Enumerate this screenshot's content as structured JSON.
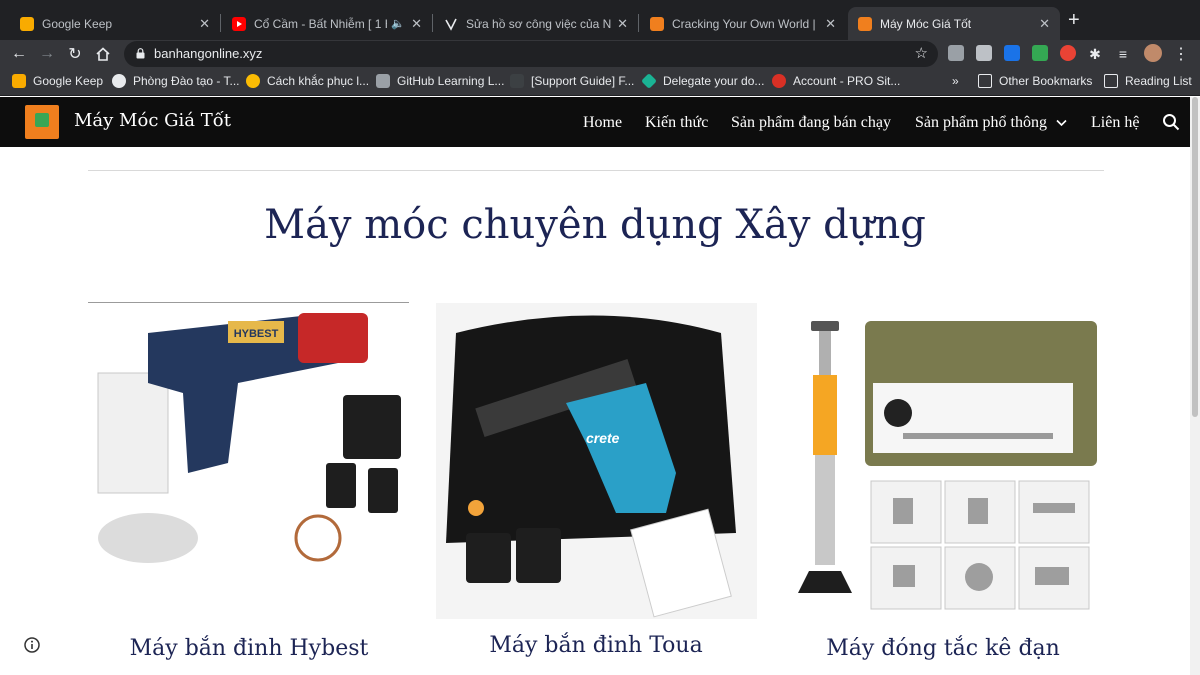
{
  "browser": {
    "tabs": [
      {
        "title": "Google Keep",
        "active": false
      },
      {
        "title": "Cổ Cầm - Bất Nhiễm [ 1 Ho",
        "active": false
      },
      {
        "title": "Sửa hồ sơ công việc của Nguy",
        "active": false
      },
      {
        "title": "Cracking Your Own World | Jus",
        "active": false
      },
      {
        "title": "Máy Móc Giá Tốt",
        "active": true
      }
    ],
    "url": "banhangonline.xyz",
    "bookmarks": [
      "Google Keep",
      "Phòng Đào tạo - T...",
      "Cách khắc phục l...",
      "GitHub Learning L...",
      "[Support Guide] F...",
      "Delegate your do...",
      "Account - PRO Sit..."
    ],
    "bookmarks_overflow": "»",
    "other_bookmarks": "Other Bookmarks",
    "reading_list": "Reading List"
  },
  "site": {
    "name": "Máy Móc Giá Tốt",
    "nav": [
      "Home",
      "Kiến thức",
      "Sản phẩm đang bán chạy",
      "Sản phẩm phổ thông",
      "Liên hệ"
    ]
  },
  "content": {
    "heading": "Máy móc chuyên dụng Xây dựng",
    "products": [
      {
        "title": "Máy bắn đinh Hybest",
        "label": "HYBEST"
      },
      {
        "title": "Máy bắn đinh Toua",
        "label": "crete"
      },
      {
        "title": "Máy đóng tắc kê đạn",
        "label": ""
      }
    ]
  },
  "colors": {
    "accent": "#1c2454",
    "header_bg": "#0d0d0d",
    "logo": "#f07f1e"
  }
}
